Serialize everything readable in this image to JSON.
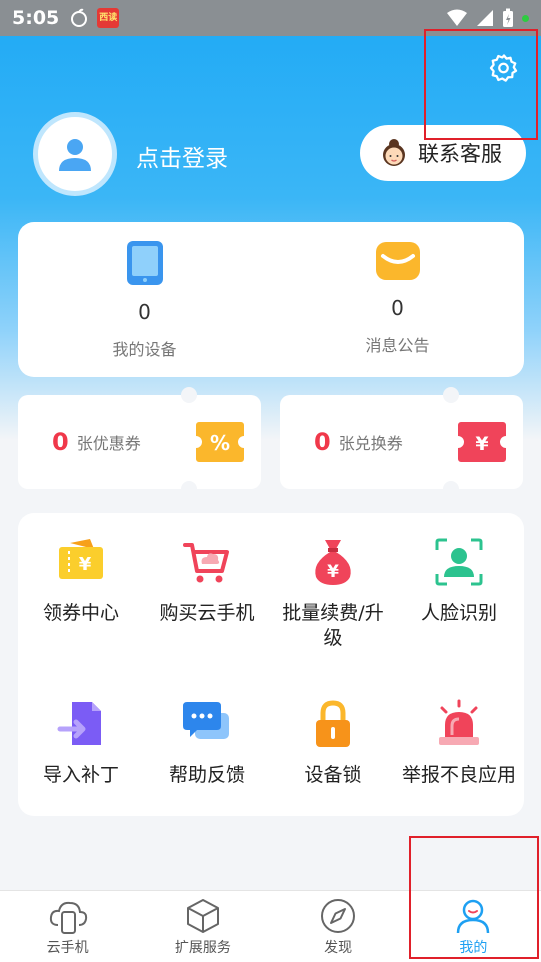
{
  "status_bar": {
    "time": "5:05",
    "app_badge": "西读"
  },
  "header": {
    "login_text": "点击登录",
    "customer_service_label": "联系客服"
  },
  "stats": [
    {
      "count": "0",
      "label": "我的设备",
      "icon": "tablet-icon"
    },
    {
      "count": "0",
      "label": "消息公告",
      "icon": "mail-icon"
    }
  ],
  "coupons": [
    {
      "count": "0",
      "label": "张优惠券",
      "icon_text": "%",
      "color": "#fbb72c"
    },
    {
      "count": "0",
      "label": "张兑换券",
      "icon_text": "¥",
      "color": "#f0445a"
    }
  ],
  "grid": [
    {
      "label": "领券中心",
      "icon": "coupon-center-icon"
    },
    {
      "label": "购买云手机",
      "icon": "cart-icon"
    },
    {
      "label": "批量续费/升\n级",
      "icon": "money-bag-icon"
    },
    {
      "label": "人脸识别",
      "icon": "face-id-icon"
    },
    {
      "label": "导入补丁",
      "icon": "import-file-icon"
    },
    {
      "label": "帮助反馈",
      "icon": "chat-icon"
    },
    {
      "label": "设备锁",
      "icon": "lock-icon"
    },
    {
      "label": "举报不良应用",
      "icon": "alarm-icon"
    }
  ],
  "tabs": [
    {
      "label": "云手机",
      "icon": "cloud-phone-icon",
      "active": false
    },
    {
      "label": "扩展服务",
      "icon": "cube-icon",
      "active": false
    },
    {
      "label": "发现",
      "icon": "compass-icon",
      "active": false
    },
    {
      "label": "我的",
      "icon": "user-icon",
      "active": true
    }
  ],
  "colors": {
    "primary": "#1ea0f2",
    "coupon_red": "#f0384a",
    "highlight_box": "#e0202a"
  }
}
